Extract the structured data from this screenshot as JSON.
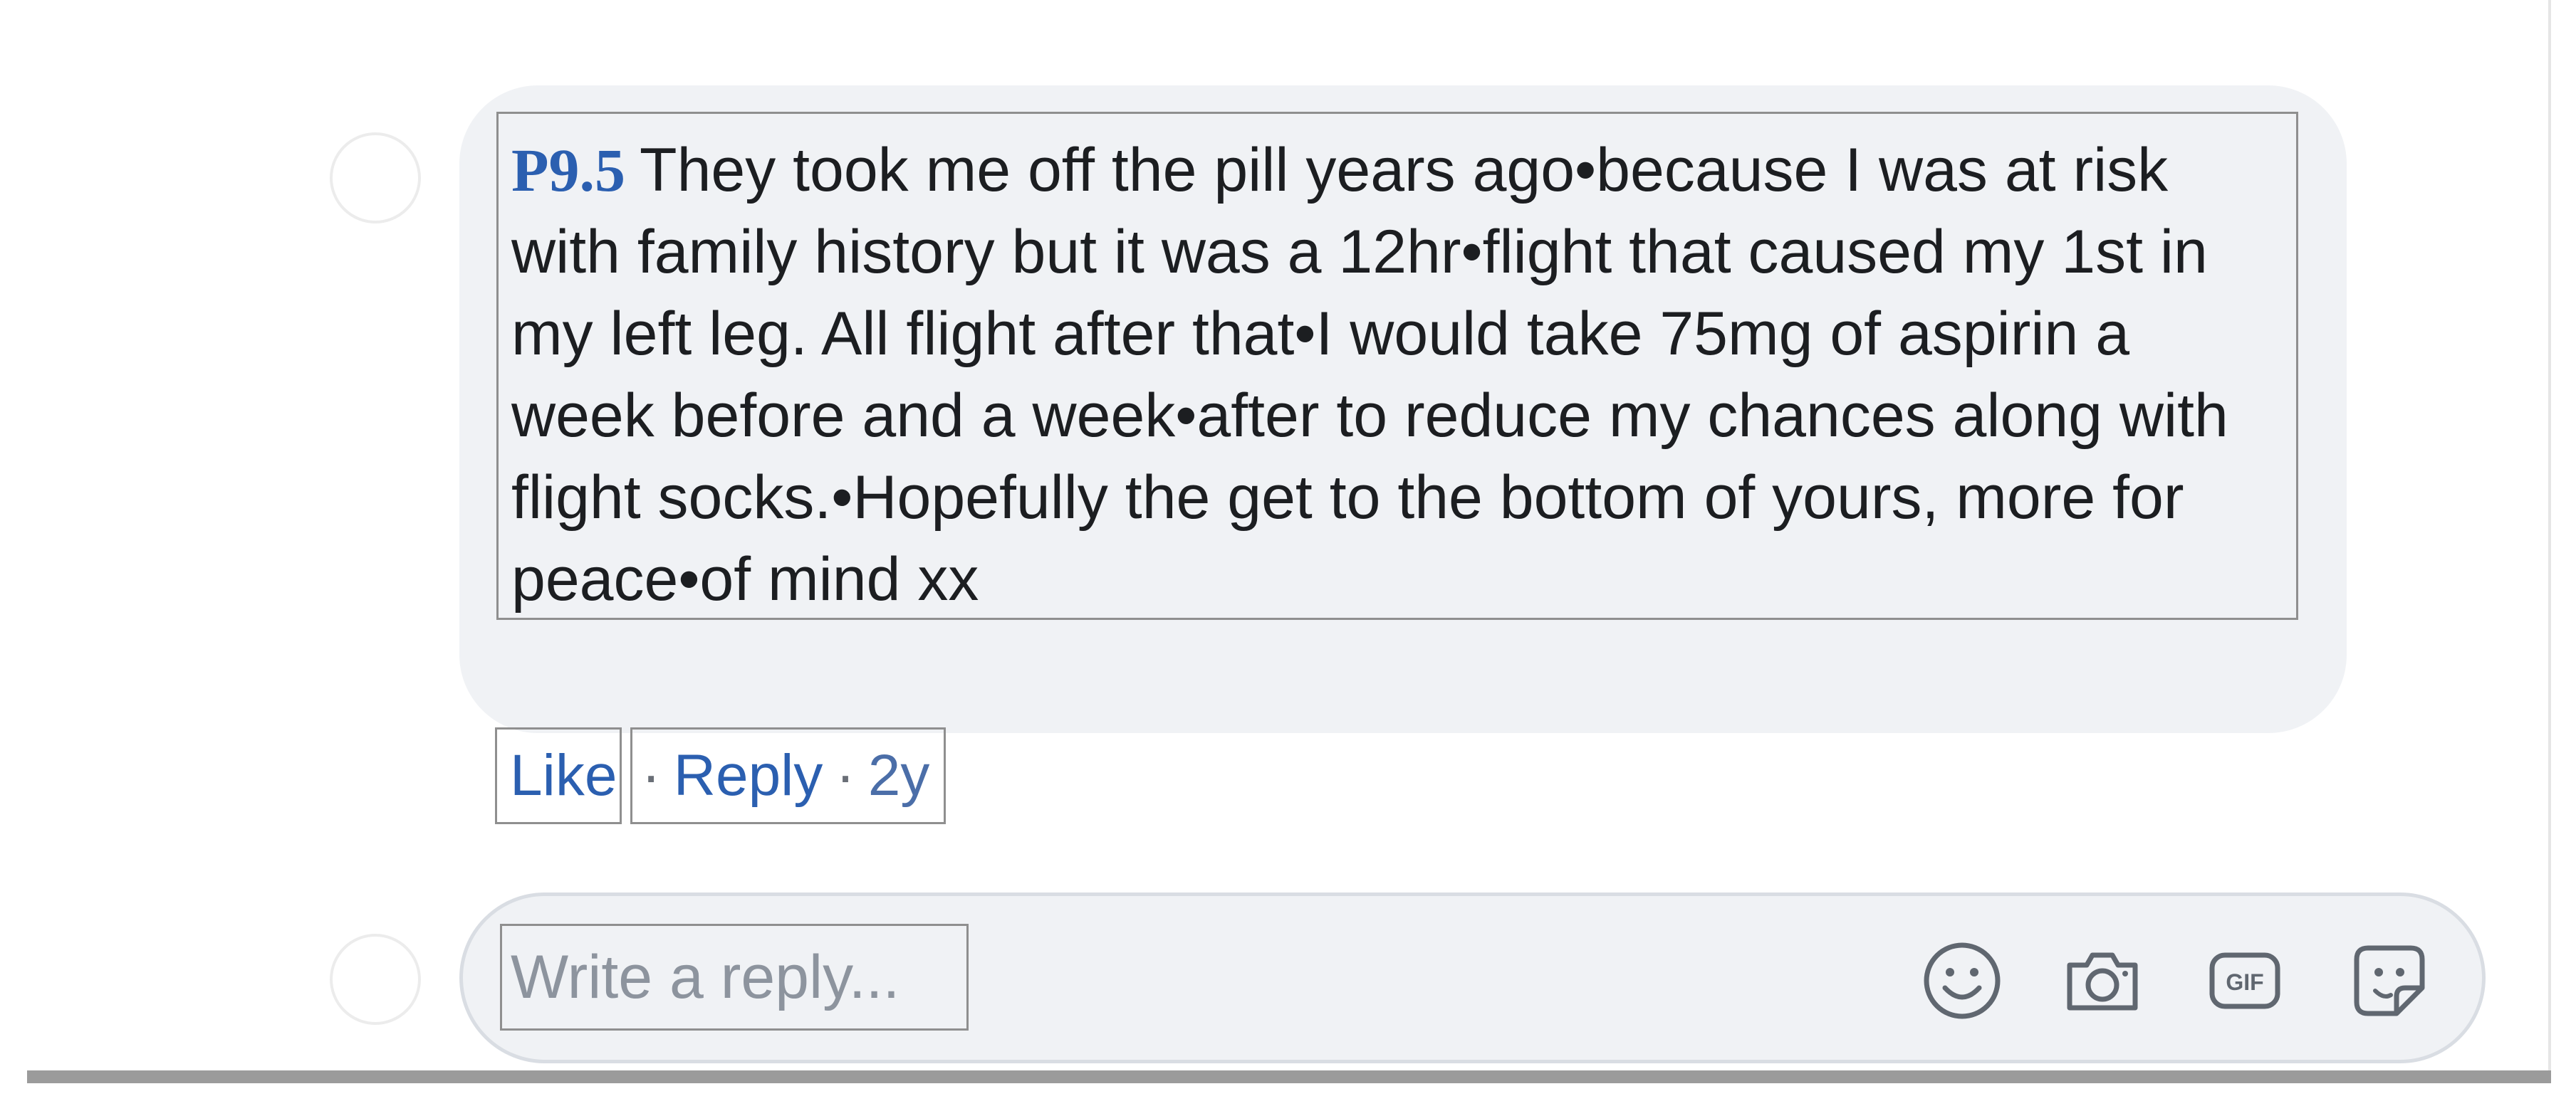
{
  "comment": {
    "tag": "P9.5",
    "text": "They took me off the pill years ago•because I was at risk with family history but it was a 12hr•flight that caused my 1st in my left leg. All flight after that•I would take 75mg of aspirin a week before and a week•after to reduce my chances along with flight socks.•Hopefully the get to the bottom of yours, more for peace•of mind xx"
  },
  "actions": {
    "like": "Like",
    "separator": "·",
    "reply": "Reply",
    "time": "2y"
  },
  "reply_box": {
    "placeholder": "Write a reply..."
  },
  "icons": [
    "emoji-icon",
    "camera-icon",
    "gif-icon",
    "sticker-icon"
  ],
  "colors": {
    "link": "#2b5fb0",
    "bubble": "#f0f2f5",
    "placeholder": "#8d949e"
  }
}
